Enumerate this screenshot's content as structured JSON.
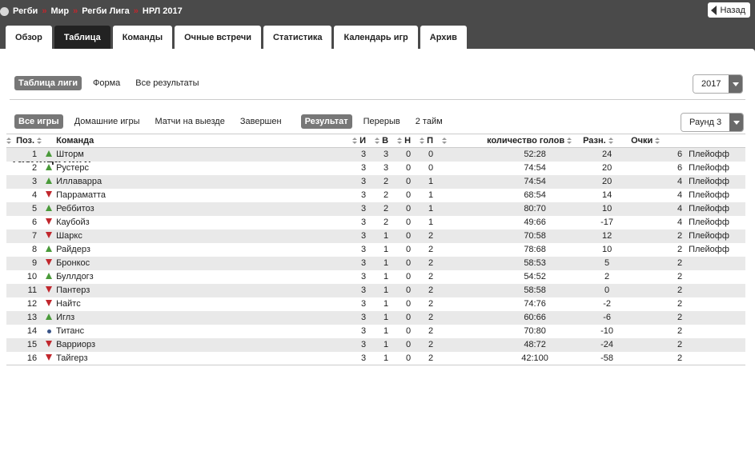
{
  "breadcrumb": [
    "Регби",
    "Мир",
    "Регби Лига",
    "НРЛ 2017"
  ],
  "back_label": "Назад",
  "tabs": [
    "Обзор",
    "Таблица",
    "Команды",
    "Очные встречи",
    "Статистика",
    "Календарь игр",
    "Архив"
  ],
  "active_tab": 1,
  "sub_tabs": [
    "Таблица лиги",
    "Форма",
    "Все результаты"
  ],
  "season_select": "2017",
  "filter_tabs": [
    "Все игры",
    "Домашние игры",
    "Матчи на выезде",
    "Завершен",
    "Результат",
    "Перерыв",
    "2 тайм"
  ],
  "round_select": "Раунд 3",
  "section_title": "Таблица лиги",
  "columns": {
    "pos": "Поз.",
    "team": "Команда",
    "played": "И",
    "won": "В",
    "drawn": "Н",
    "lost": "П",
    "goals": "количество голов",
    "diff": "Разн.",
    "points": "Очки"
  },
  "colors": {
    "up": "#4a9a3a",
    "down": "#c1272d",
    "same": "#3a5588",
    "accent": "#c1272d"
  },
  "rows": [
    {
      "pos": "1",
      "trend": "up",
      "team": "Шторм",
      "played": "3",
      "won": "3",
      "drawn": "0",
      "lost": "0",
      "goals": "52:28",
      "diff": "24",
      "points": "6",
      "note": "Плейофф"
    },
    {
      "pos": "2",
      "trend": "up",
      "team": "Рустерс",
      "played": "3",
      "won": "3",
      "drawn": "0",
      "lost": "0",
      "goals": "74:54",
      "diff": "20",
      "points": "6",
      "note": "Плейофф"
    },
    {
      "pos": "3",
      "trend": "up",
      "team": "Иллаварра",
      "played": "3",
      "won": "2",
      "drawn": "0",
      "lost": "1",
      "goals": "74:54",
      "diff": "20",
      "points": "4",
      "note": "Плейофф"
    },
    {
      "pos": "4",
      "trend": "down",
      "team": "Парраматта",
      "played": "3",
      "won": "2",
      "drawn": "0",
      "lost": "1",
      "goals": "68:54",
      "diff": "14",
      "points": "4",
      "note": "Плейофф"
    },
    {
      "pos": "5",
      "trend": "up",
      "team": "Реббитоз",
      "played": "3",
      "won": "2",
      "drawn": "0",
      "lost": "1",
      "goals": "80:70",
      "diff": "10",
      "points": "4",
      "note": "Плейофф"
    },
    {
      "pos": "6",
      "trend": "down",
      "team": "Каубойз",
      "played": "3",
      "won": "2",
      "drawn": "0",
      "lost": "1",
      "goals": "49:66",
      "diff": "-17",
      "points": "4",
      "note": "Плейофф"
    },
    {
      "pos": "7",
      "trend": "down",
      "team": "Шаркс",
      "played": "3",
      "won": "1",
      "drawn": "0",
      "lost": "2",
      "goals": "70:58",
      "diff": "12",
      "points": "2",
      "note": "Плейофф"
    },
    {
      "pos": "8",
      "trend": "up",
      "team": "Райдерз",
      "played": "3",
      "won": "1",
      "drawn": "0",
      "lost": "2",
      "goals": "78:68",
      "diff": "10",
      "points": "2",
      "note": "Плейофф"
    },
    {
      "pos": "9",
      "trend": "down",
      "team": "Бронкос",
      "played": "3",
      "won": "1",
      "drawn": "0",
      "lost": "2",
      "goals": "58:53",
      "diff": "5",
      "points": "2",
      "note": ""
    },
    {
      "pos": "10",
      "trend": "up",
      "team": "Буллдогз",
      "played": "3",
      "won": "1",
      "drawn": "0",
      "lost": "2",
      "goals": "54:52",
      "diff": "2",
      "points": "2",
      "note": ""
    },
    {
      "pos": "11",
      "trend": "down",
      "team": "Пантерз",
      "played": "3",
      "won": "1",
      "drawn": "0",
      "lost": "2",
      "goals": "58:58",
      "diff": "0",
      "points": "2",
      "note": ""
    },
    {
      "pos": "12",
      "trend": "down",
      "team": "Найтс",
      "played": "3",
      "won": "1",
      "drawn": "0",
      "lost": "2",
      "goals": "74:76",
      "diff": "-2",
      "points": "2",
      "note": ""
    },
    {
      "pos": "13",
      "trend": "up",
      "team": "Иглз",
      "played": "3",
      "won": "1",
      "drawn": "0",
      "lost": "2",
      "goals": "60:66",
      "diff": "-6",
      "points": "2",
      "note": ""
    },
    {
      "pos": "14",
      "trend": "same",
      "team": "Титанс",
      "played": "3",
      "won": "1",
      "drawn": "0",
      "lost": "2",
      "goals": "70:80",
      "diff": "-10",
      "points": "2",
      "note": ""
    },
    {
      "pos": "15",
      "trend": "down",
      "team": "Варриорз",
      "played": "3",
      "won": "1",
      "drawn": "0",
      "lost": "2",
      "goals": "48:72",
      "diff": "-24",
      "points": "2",
      "note": ""
    },
    {
      "pos": "16",
      "trend": "down",
      "team": "Тайгерз",
      "played": "3",
      "won": "1",
      "drawn": "0",
      "lost": "2",
      "goals": "42:100",
      "diff": "-58",
      "points": "2",
      "note": ""
    }
  ]
}
